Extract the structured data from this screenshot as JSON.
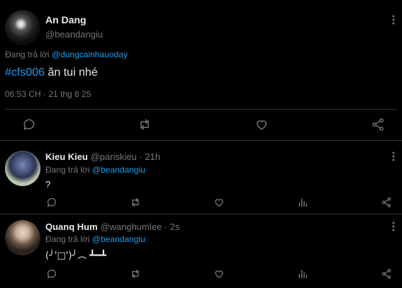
{
  "main_tweet": {
    "author_name": "An Dang",
    "handle": "@beandangiu",
    "reply_prefix": "Đang trả lời ",
    "reply_to": "@dungcainhauoday",
    "hashtag": "#cfs006",
    "text": " ăn tui nhé",
    "timestamp": "06:53 CH · 21 thg 8 25",
    "actions": [
      "reply-icon",
      "retweet-icon",
      "like-icon",
      "share-icon"
    ]
  },
  "replies": [
    {
      "author_name": "Kieu Kieu",
      "meta": "@pariskieu · 21h",
      "reply_prefix": "Đang trả lời ",
      "reply_to": "@beandangiu",
      "text": "?",
      "actions": [
        "reply-icon",
        "retweet-icon",
        "like-icon",
        "analytics-icon",
        "share-icon"
      ]
    },
    {
      "author_name": "Quanq Hum",
      "meta": "@wanghumlee · 2s",
      "reply_prefix": "Đang trả lời ",
      "reply_to": "@beandangiu",
      "text": "(╯'□')╯︵ ┻━┻",
      "actions": [
        "reply-icon",
        "retweet-icon",
        "like-icon",
        "analytics-icon",
        "share-icon"
      ]
    }
  ],
  "colors": {
    "background": "#000000",
    "text": "#e7e9ea",
    "muted": "#71767b",
    "link": "#1d9bf0",
    "divider": "#2f3336"
  }
}
